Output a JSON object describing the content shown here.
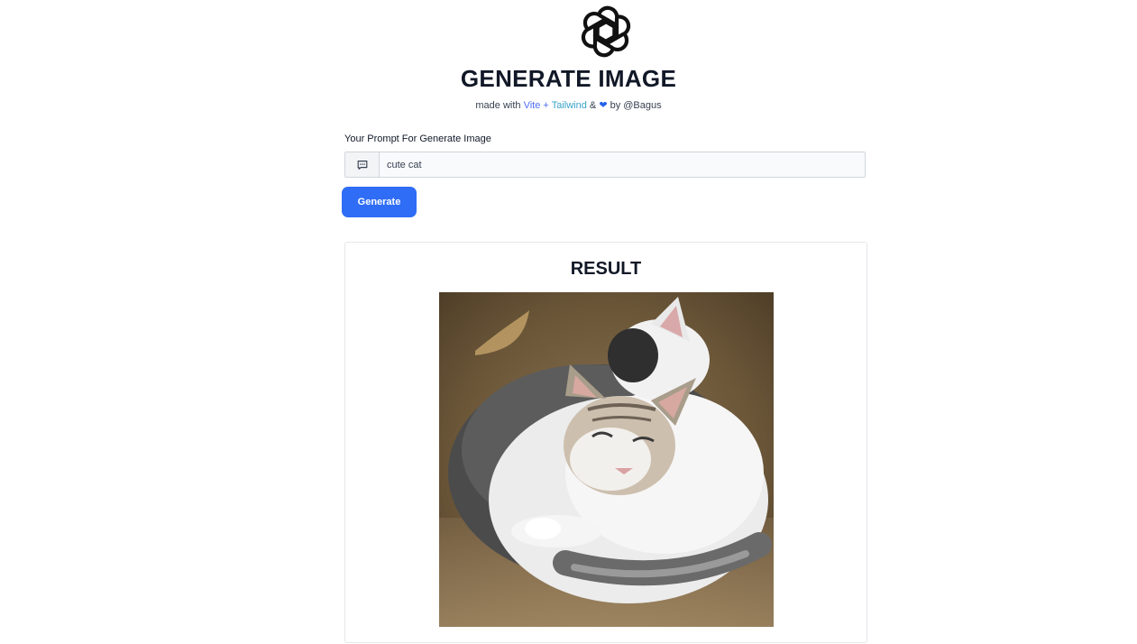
{
  "header": {
    "title": "GENERATE IMAGE",
    "subtitle_prefix": "made with",
    "vite": "Vite",
    "plus": "+",
    "tailwind": "Tailwind",
    "amp": "&",
    "by": "by @Bagus"
  },
  "form": {
    "label": "Your Prompt For Generate Image",
    "prompt_value": "cute cat",
    "generate_label": "Generate"
  },
  "result": {
    "title": "RESULT",
    "image_alt": "cute cat"
  },
  "colors": {
    "accent": "#2f6df6",
    "vite": "#4f6ef7",
    "tailwind": "#38a3c9"
  }
}
